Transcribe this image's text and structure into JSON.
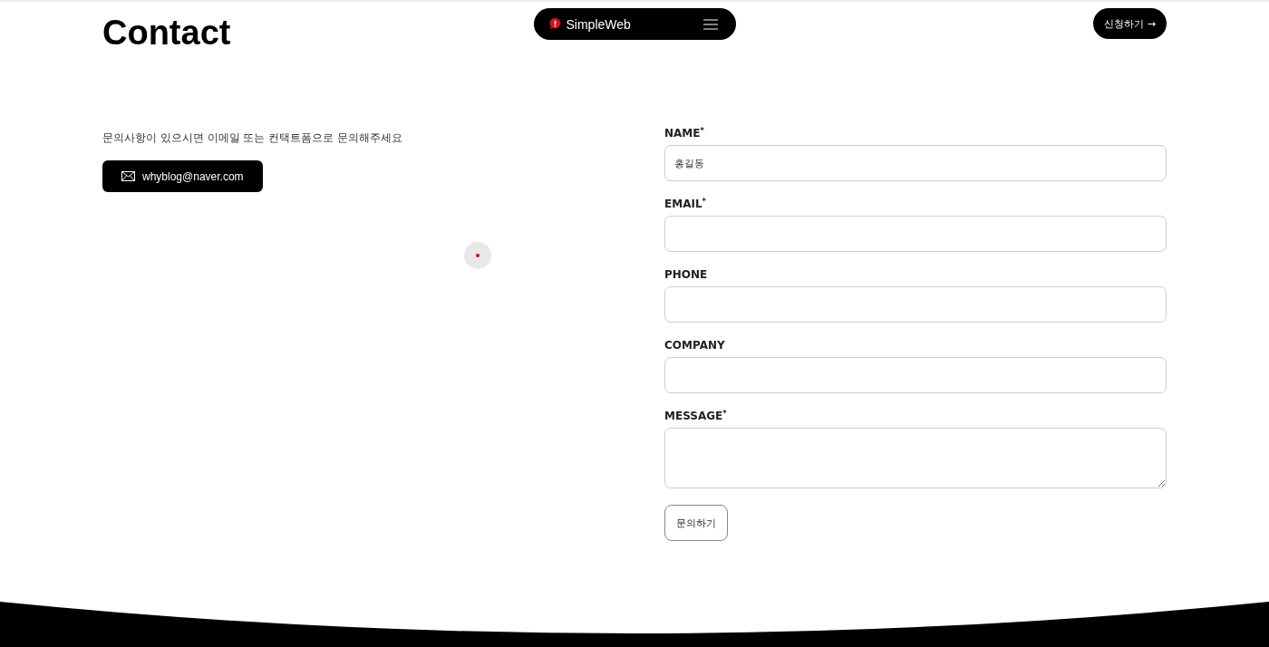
{
  "header": {
    "title": "Contact",
    "brand": "SimpleWeb",
    "cta": "신청하기 →"
  },
  "intro": {
    "text": "문의사항이 있으시면 이메일 또는 컨택트폼으로 문의해주세요",
    "email": "whyblog@naver.com"
  },
  "form": {
    "fields": [
      {
        "kind": "input",
        "label": "NAME$^{*}$",
        "value": "홍길동"
      },
      {
        "kind": "input",
        "label": "EMAIL$^{*}$"
      },
      {
        "kind": "input",
        "label": "PHONE"
      },
      {
        "kind": "input",
        "label": "COMPANY"
      },
      {
        "kind": "textarea",
        "label": "MESSAGE$^{*}$"
      }
    ],
    "submit": "문의하기"
  }
}
